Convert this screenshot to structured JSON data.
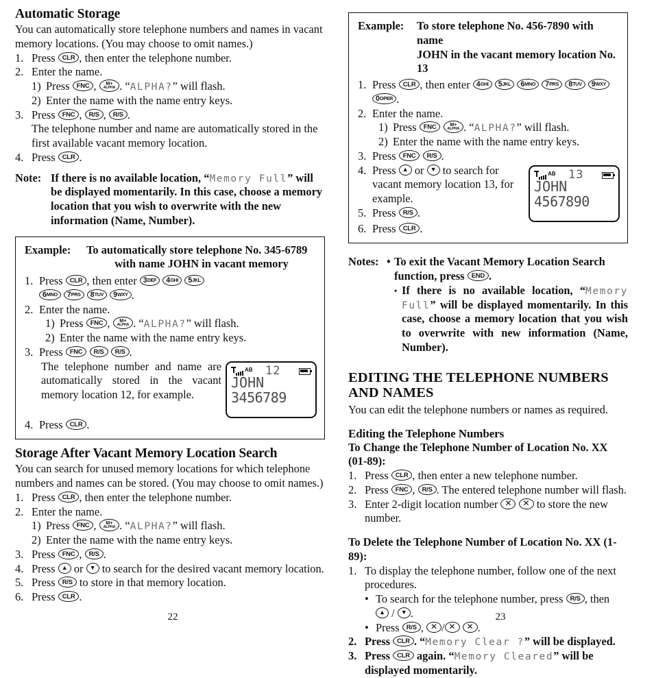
{
  "left_page": {
    "page_number": "22",
    "section_title": "Automatic Storage",
    "intro": "You can automatically store telephone numbers and names in vacant memory locations. (You may choose to omit names.)",
    "steps": [
      {
        "num": "1.",
        "pre": "Press",
        "keys": [
          "CLR"
        ],
        "post": ", then enter the telephone number."
      },
      {
        "num": "2.",
        "text": "Enter the name."
      },
      {
        "num": "1)",
        "pre": "Press",
        "keys": [
          "FNC",
          "M+ALPHA"
        ],
        "post": ". “ALPHA?” will flash.",
        "lcd": "ALPHA?"
      },
      {
        "num": "2)",
        "text": "Enter the name with the name entry keys."
      },
      {
        "num": "3.",
        "pre": "Press",
        "keys": [
          "FNC",
          "R/S",
          "R/S"
        ],
        "post": "."
      },
      {
        "num": "",
        "text": "The telephone number and name are automatically stored in the first available vacant memory location."
      },
      {
        "num": "4.",
        "pre": "Press",
        "keys": [
          "CLR"
        ],
        "post": "."
      }
    ],
    "note_label": "Note:",
    "note_pre": "If there is no available location, “",
    "note_lcd": "Memory Full",
    "note_post": "” will be displayed momentarily. In this case, choose a memory location that you wish to overwrite with the new information (Name, Number).",
    "example": {
      "label": "Example:",
      "title_line1": "To automatically store telephone No. 345-6789",
      "title_line2": "with name JOHN in vacant memory",
      "steps": [
        {
          "num": "1.",
          "pre": "Press",
          "keys": [
            "CLR"
          ],
          "post": ", then enter",
          "digit_keys": [
            "3DEF",
            "4GHI",
            "5JKL"
          ]
        },
        {
          "num": "",
          "digit_keys_line": [
            "6MNO",
            "7PRS",
            "8TUV",
            "9WXY"
          ],
          "trail": "."
        },
        {
          "num": "2.",
          "text": "Enter the name."
        },
        {
          "num": "1)",
          "pre": "Press",
          "keys": [
            "FNC",
            "M+ALPHA"
          ],
          "post": ". “ALPHA?” will flash.",
          "lcd": "ALPHA?"
        },
        {
          "num": "2)",
          "text": "Enter the name with the name entry keys."
        },
        {
          "num": "3.",
          "pre": "Press",
          "keys": [
            "FNC",
            "R/S",
            "R/S"
          ],
          "post": "."
        },
        {
          "num": "",
          "text": "The telephone number and name are automatically stored in the vacant memory location 12, for example."
        },
        {
          "num": "4.",
          "pre": "Press",
          "keys": [
            "CLR"
          ],
          "post": "."
        }
      ],
      "screen": {
        "status": "AB",
        "location": "12",
        "name": "JOHN",
        "number": "3456789"
      }
    },
    "section2_title": "Storage After Vacant Memory Location Search",
    "section2_intro": "You can search for unused memory locations for which telephone numbers and names can be stored. (You may choose to omit names.)",
    "section2_steps": [
      {
        "num": "1.",
        "pre": "Press",
        "keys": [
          "CLR"
        ],
        "post": ", then enter the telephone number."
      },
      {
        "num": "2.",
        "text": "Enter the name."
      },
      {
        "num": "1)",
        "pre": "Press",
        "keys": [
          "FNC",
          "M+ALPHA"
        ],
        "post": ". “ALPHA?” will flash.",
        "lcd": "ALPHA?"
      },
      {
        "num": "2)",
        "text": "Enter the name with the name entry keys."
      },
      {
        "num": "3.",
        "pre": "Press",
        "keys": [
          "FNC",
          "R/S"
        ],
        "post": "."
      },
      {
        "num": "4.",
        "pre": "Press",
        "keys": [
          "UP"
        ],
        "mid": "or",
        "keys2": [
          "DOWN"
        ],
        "post": "to search for the desired vacant memory location."
      },
      {
        "num": "5.",
        "pre": "Press",
        "keys": [
          "R/S"
        ],
        "post": "to store in that memory location."
      },
      {
        "num": "6.",
        "pre": "Press",
        "keys": [
          "CLR"
        ],
        "post": "."
      }
    ]
  },
  "right_page": {
    "page_number": "23",
    "example": {
      "label": "Example:",
      "title_line1": "To store telephone No. 456-7890 with name",
      "title_line2": "JOHN in the vacant memory location No. 13",
      "steps": [
        {
          "num": "1.",
          "pre": "Press",
          "keys": [
            "CLR"
          ],
          "post": ", then enter",
          "digit_keys": [
            "4GHI",
            "5JKL",
            "6MNO",
            "7PRS",
            "8TUV",
            "9WXY",
            "0OPER"
          ],
          "trail": "."
        },
        {
          "num": "2.",
          "text": "Enter the name."
        },
        {
          "num": "1)",
          "pre": "Press",
          "keys": [
            "FNC",
            "M+ALPHA"
          ],
          "post": ". “ALPHA?” will flash.",
          "lcd": "ALPHA?"
        },
        {
          "num": "2)",
          "text": "Enter the name with the name entry keys."
        },
        {
          "num": "3.",
          "pre": "Press",
          "keys": [
            "FNC",
            "R/S"
          ],
          "post": "."
        },
        {
          "num": "4.",
          "pre": "Press",
          "keys": [
            "UP"
          ],
          "mid": "or",
          "keys2": [
            "DOWN"
          ],
          "post": "to search for vacant memory location 13, for example."
        },
        {
          "num": "5.",
          "pre": "Press",
          "keys": [
            "R/S"
          ],
          "post": "."
        },
        {
          "num": "6.",
          "pre": "Press",
          "keys": [
            "CLR"
          ],
          "post": "."
        }
      ],
      "screen": {
        "status": "AB",
        "location": "13",
        "name": "JOHN",
        "number": "4567890"
      }
    },
    "notes_label": "Notes:",
    "notes": [
      {
        "pre": "To exit the Vacant Memory Location Search function, press",
        "keys": [
          "END"
        ],
        "post": "."
      },
      {
        "pre": "If there is no available location, “",
        "lcd": "Memory Full",
        "post": "” will be displayed momentarily. In this case, choose a memory location that you wish to overwrite with new information (Name, Number)."
      }
    ],
    "heading_line1": "EDITING THE TELEPHONE NUMBERS",
    "heading_line2": "AND NAMES",
    "heading_intro": "You can edit the telephone numbers or names as required.",
    "subsection_title": "Editing the Telephone Numbers",
    "change_title_line1": "To Change the Telephone Number of Location No. XX",
    "change_title_line2": "(01-89):",
    "change_steps": [
      {
        "num": "1.",
        "pre": "Press",
        "keys": [
          "CLR"
        ],
        "post": ", then enter a new telephone number."
      },
      {
        "num": "2.",
        "pre": "Press",
        "keys": [
          "FNC",
          "R/S"
        ],
        "post": ". The entered telephone number will flash."
      },
      {
        "num": "3.",
        "pre": "Enter 2-digit location number",
        "keys": [
          "X",
          "X"
        ],
        "post": "to store the new number."
      }
    ],
    "delete_title_line1": "To Delete the Telephone Number of Location No. XX (1-",
    "delete_title_line2": "89):",
    "delete_steps": [
      {
        "num": "1.",
        "text": "To display the telephone number, follow one of the next procedures."
      },
      {
        "bullet": "•",
        "pre": "To search for the telephone number, press",
        "keys": [
          "R/S"
        ],
        "post": ", then"
      },
      {
        "bullet": "",
        "keys_only": [
          "UP",
          "/",
          "DOWN"
        ],
        "trail": "."
      },
      {
        "bullet": "•",
        "pre": "Press",
        "keys": [
          "R/S"
        ],
        "sep": ",",
        "keys2": [
          "X",
          "/",
          "X",
          "X"
        ],
        "trail": "."
      },
      {
        "num": "2.",
        "pre": "Press",
        "keys": [
          "CLR"
        ],
        "mid_q": ". “",
        "lcd": "Memory Clear ?",
        "post": "” will be displayed."
      },
      {
        "num": "3.",
        "pre": "Press",
        "keys": [
          "CLR"
        ],
        "mid_q": " again. “",
        "lcd": "Memory Cleared",
        "post": "” will be displayed momentarily."
      }
    ]
  }
}
